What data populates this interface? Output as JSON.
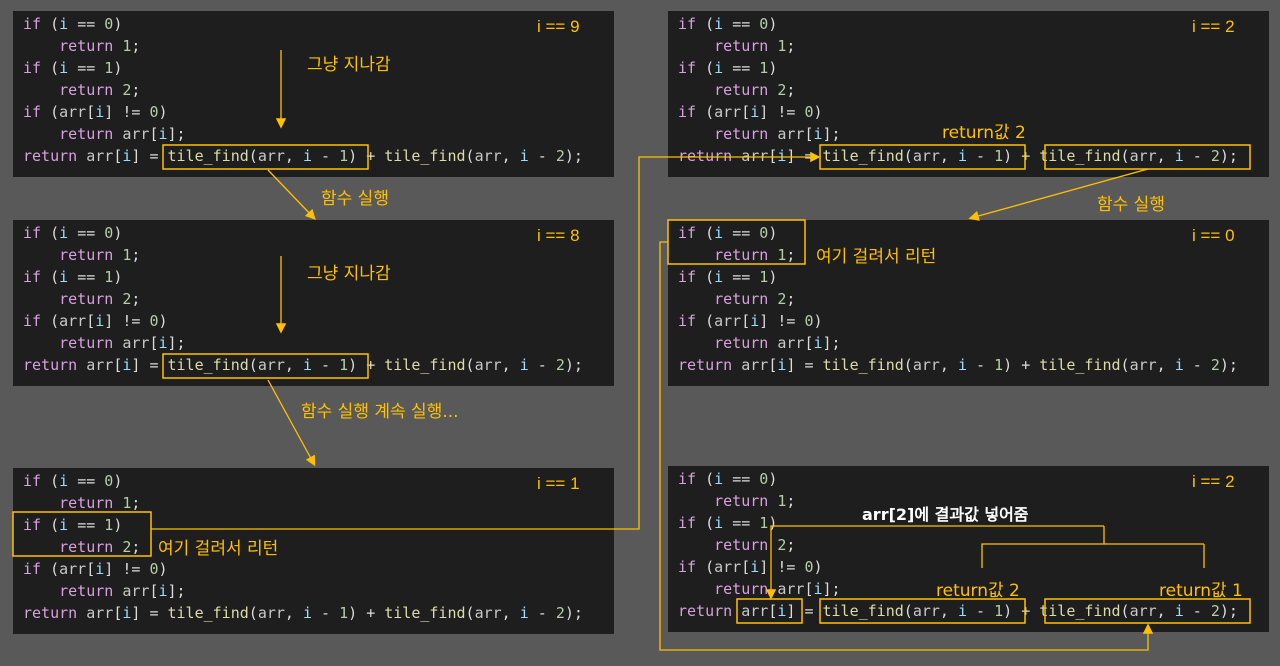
{
  "panels": [
    {
      "index": "i == 9"
    },
    {
      "index": "i == 8"
    },
    {
      "index": "i == 1"
    },
    {
      "index": "i == 2"
    },
    {
      "index": "i == 0"
    },
    {
      "index": "i == 2"
    }
  ],
  "code": {
    "if": "if",
    "return": "return",
    "i": "i",
    "arr": "arr",
    "fn": "tile_find",
    "zero": "0",
    "one": "1",
    "two": "2",
    "eq": "==",
    "neq": "!=",
    "plus": "+",
    "minus": "-",
    "assign": "="
  },
  "notes": {
    "pass1": "그냥 지나감",
    "pass2": "그냥 지나감",
    "call1": "함수 실행",
    "call2": "함수 실행 계속 실행...",
    "call3": "함수 실행",
    "ret1": "여기 걸려서 리턴",
    "ret0": "여기 걸려서 리턴",
    "retval2_top": "return값 2",
    "retval2_bottom": "return값 2",
    "retval1_bottom": "return값 1",
    "store": "arr[2]에 결과값 넣어줌"
  }
}
